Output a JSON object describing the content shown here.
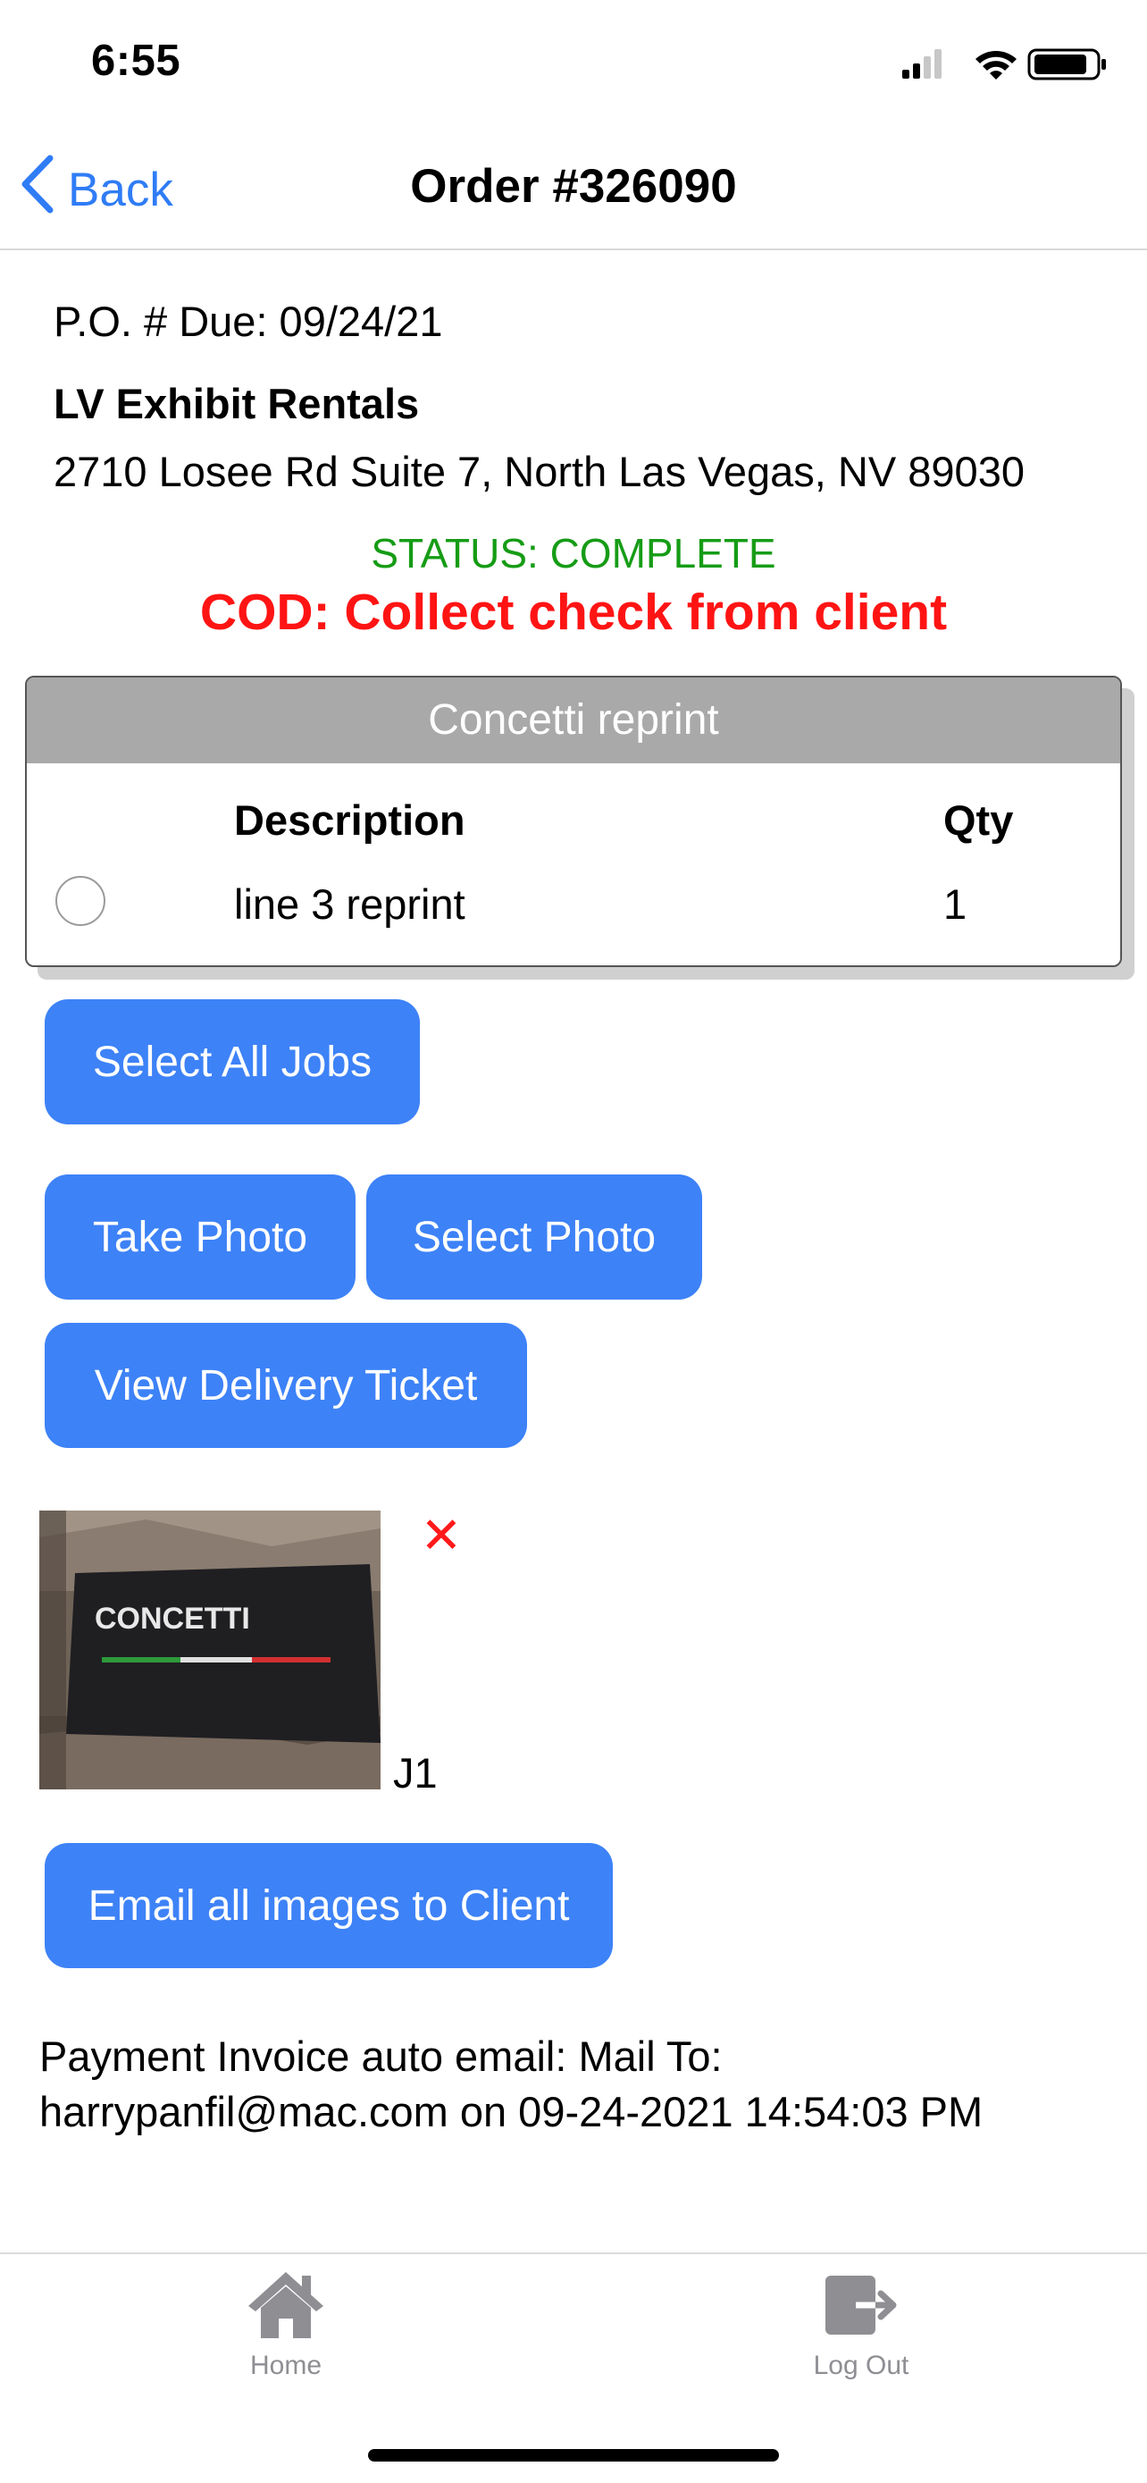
{
  "status_bar": {
    "time": "6:55",
    "signal_icon": "cellular-signal-icon",
    "wifi_icon": "wifi-icon",
    "battery_icon": "battery-icon"
  },
  "nav": {
    "back_label": "Back",
    "back_icon": "chevron-left-icon",
    "title": "Order #326090"
  },
  "order": {
    "po_due": "P.O. # Due: 09/24/21",
    "company": "LV Exhibit Rentals",
    "address": "2710 Losee Rd Suite 7, North Las Vegas, NV 89030",
    "status": "STATUS: COMPLETE",
    "cod_notice": "COD: Collect check from client"
  },
  "job_card": {
    "header": "Concetti reprint",
    "columns": {
      "description": "Description",
      "qty": "Qty"
    },
    "rows": [
      {
        "description": "line 3 reprint",
        "qty": "1",
        "selected": false
      }
    ]
  },
  "buttons": {
    "select_all": "Select All Jobs",
    "take_photo": "Take Photo",
    "select_photo": "Select Photo",
    "view_ticket": "View Delivery Ticket",
    "email_all": "Email all images to Client"
  },
  "photo": {
    "label": "J1",
    "delete_icon": "close-x-icon",
    "sign_text": "CONCETTI"
  },
  "invoice_note": {
    "line1": "Payment Invoice auto email: Mail To:",
    "line2": "harrypanfil@mac.com on 09-24-2021 14:54:03 PM"
  },
  "tabbar": {
    "home": "Home",
    "logout": "Log Out",
    "home_icon": "house-icon",
    "logout_icon": "logout-arrow-icon"
  },
  "colors": {
    "accent": "#3d82f7",
    "link": "#2f7cf6",
    "status_ok": "#169c16",
    "alert": "#ff1414",
    "card_header": "#a9a9a9"
  }
}
